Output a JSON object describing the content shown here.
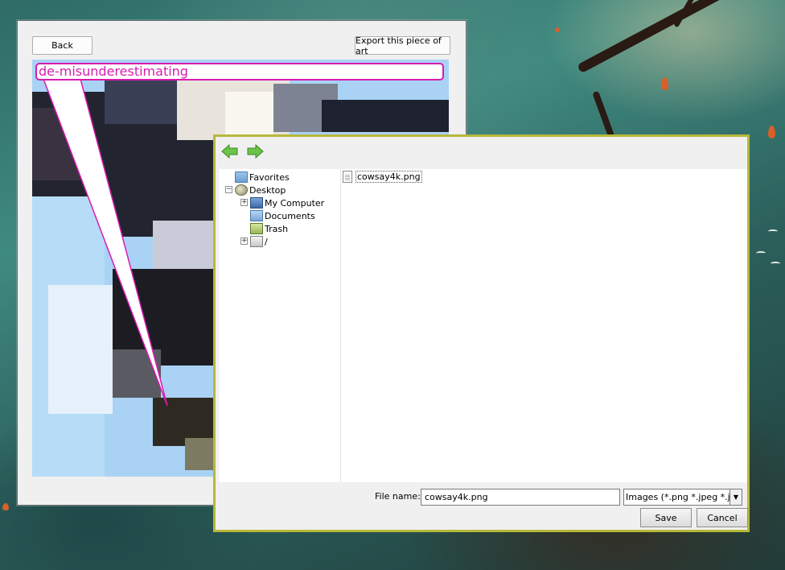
{
  "art_window": {
    "back_label": "Back",
    "export_label": "Export this piece of art",
    "caption_text": "de-misunderestimating"
  },
  "file_dialog": {
    "nav": {
      "back_icon": "green-left-arrow-icon",
      "forward_icon": "green-right-arrow-icon"
    },
    "tree": [
      {
        "label": "Favorites",
        "icon": "folder-icon"
      },
      {
        "label": "Desktop",
        "icon": "desktop-icon"
      },
      {
        "label": "My Computer",
        "icon": "computer-icon"
      },
      {
        "label": "Documents",
        "icon": "documents-folder-icon"
      },
      {
        "label": "Trash",
        "icon": "trash-icon"
      },
      {
        "label": "/",
        "icon": "drive-icon"
      }
    ],
    "files": [
      {
        "name": "cowsay4k.png",
        "icon": "file-icon"
      }
    ],
    "file_name_label": "File name:",
    "file_name_value": "cowsay4k.png",
    "filter_value": "Images (*.png *.jpeg *.jp",
    "save_label": "Save",
    "cancel_label": "Cancel"
  },
  "colors": {
    "caption_accent": "#d81bb0",
    "dialog_border": "#b7b83a"
  }
}
